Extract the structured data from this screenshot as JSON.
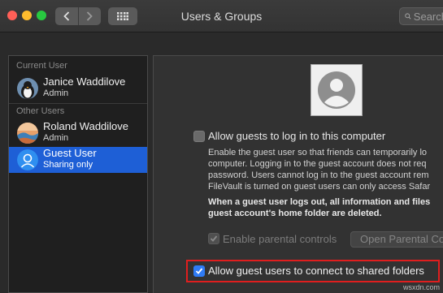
{
  "window": {
    "title": "Users & Groups",
    "search_placeholder": "Search"
  },
  "sidebar": {
    "current_user_header": "Current User",
    "other_users_header": "Other Users",
    "current_user": {
      "name": "Janice Waddilove",
      "role": "Admin"
    },
    "other_users": [
      {
        "name": "Roland Waddilove",
        "role": "Admin",
        "selected": false
      },
      {
        "name": "Guest User",
        "role": "Sharing only",
        "selected": true
      }
    ]
  },
  "main": {
    "allow_login_label": "Allow guests to log in to this computer",
    "allow_login_checked": false,
    "description_lines": [
      "Enable the guest user so that friends can temporarily lo",
      "computer. Logging in to the guest account does not req",
      "password. Users cannot log in to the guest account rem",
      "FileVault is turned on guest users can only access Safar"
    ],
    "warning_lines": [
      "When a guest user logs out, all information and files",
      "guest account's home folder are deleted."
    ],
    "parental_controls_label": "Enable parental controls",
    "parental_controls_checked": true,
    "open_parental_button": "Open Parental Co",
    "shared_folders_label": "Allow guest users to connect to shared folders",
    "shared_folders_checked": true
  },
  "watermark": "wsxdn.com",
  "colors": {
    "selection": "#1e5fd6",
    "checkbox_on": "#2f7bf5",
    "highlight": "#e01e1e"
  }
}
